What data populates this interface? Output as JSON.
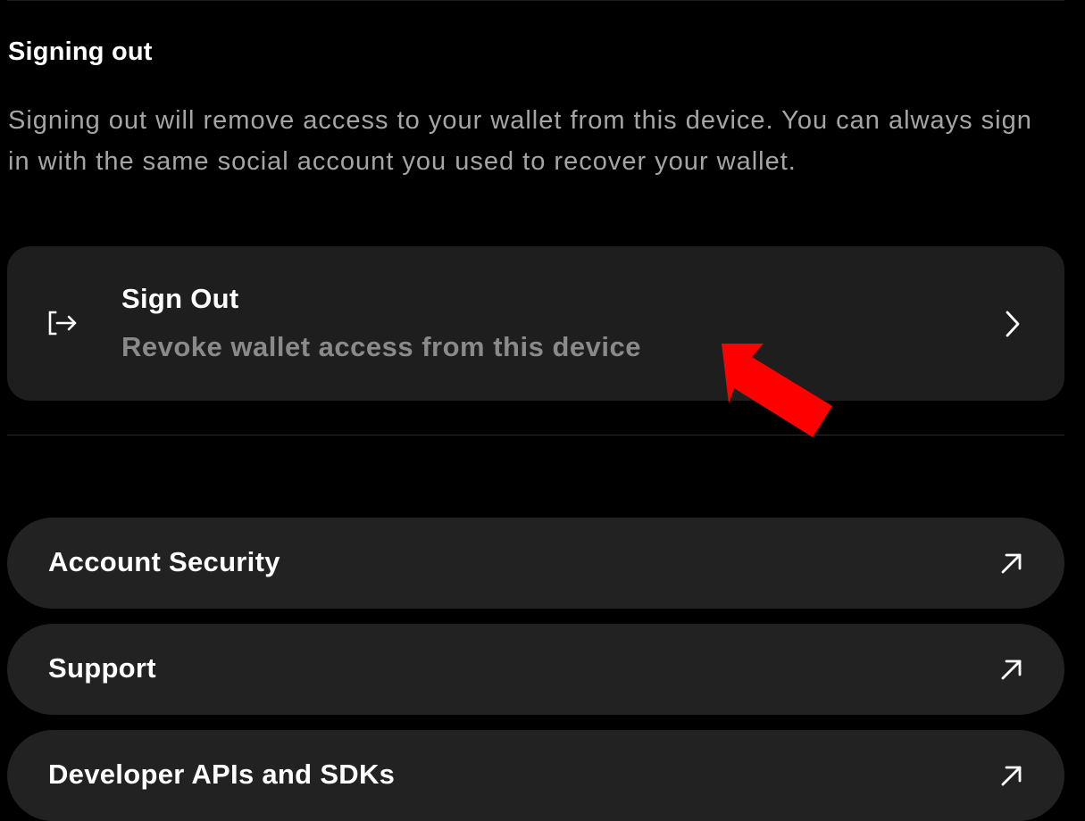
{
  "signing_out": {
    "title": "Signing out",
    "description": "Signing out will remove access to your wallet from this device. You can always sign in with the same social account you used to recover your wallet."
  },
  "sign_out_card": {
    "title": "Sign Out",
    "subtitle": "Revoke wallet access from this device",
    "icon": "sign-out-icon",
    "trailing_icon": "chevron-right-icon"
  },
  "links": [
    {
      "label": "Account Security",
      "icon": "external-link-icon"
    },
    {
      "label": "Support",
      "icon": "external-link-icon"
    },
    {
      "label": "Developer APIs and SDKs",
      "icon": "external-link-icon"
    }
  ],
  "annotation": {
    "type": "arrow",
    "color": "#ff0000"
  },
  "colors": {
    "background": "#000000",
    "card": "#1e1e1e",
    "row": "#222222",
    "text_primary": "#ffffff",
    "text_secondary": "#8a8a8a"
  }
}
